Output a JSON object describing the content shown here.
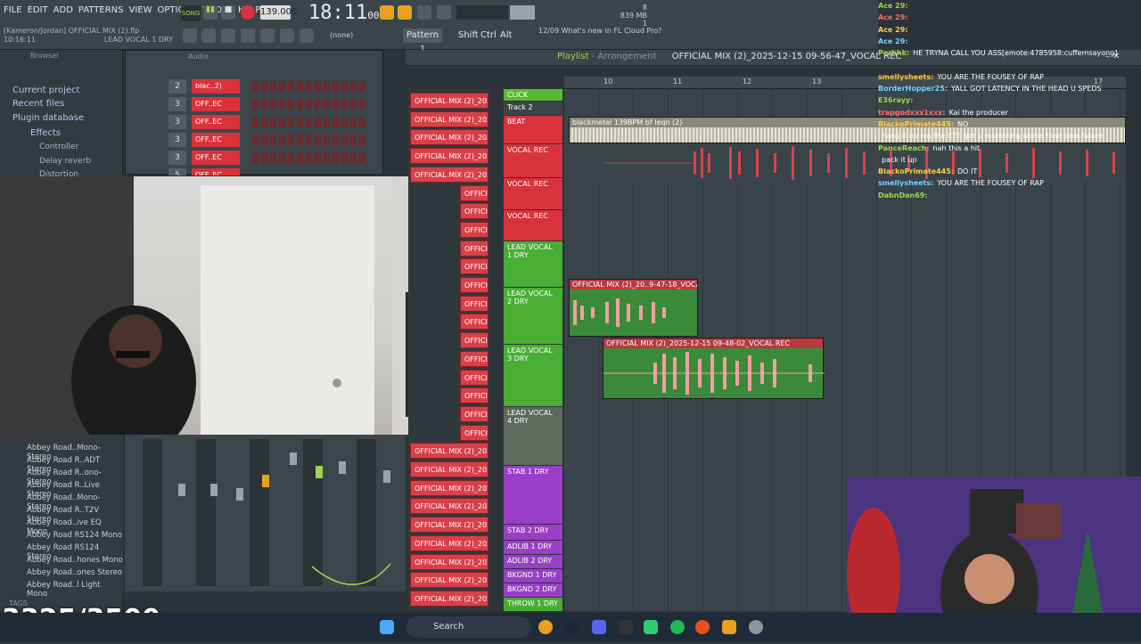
{
  "menu": [
    "FILE",
    "EDIT",
    "ADD",
    "PATTERNS",
    "VIEW",
    "OPTIONS",
    "TOOLS",
    "HELP"
  ],
  "toolbar": {
    "song_label": "SONG",
    "bpm": "139.000",
    "clock": "18:11",
    "clock_small": "00",
    "file_title": "[Kameron/Jordan] OFFICIAL MIX (2).flp",
    "time_left": "10:16:11",
    "channel_label": "LEAD VOCAL 1 DRY",
    "pattern": "Pattern 1",
    "none_label": "(none)",
    "news_date": "12/09",
    "news_text": "What's new in FL Cloud Pro?",
    "mem_a": "8",
    "mem_b": "839 MB",
    "mem_c": "1",
    "shift_label": "Shift",
    "ctrl_label": "Ctrl",
    "alt_label": "Alt"
  },
  "browser": {
    "title": "Browser",
    "items": [
      "Current project",
      "Recent files",
      "Plugin database",
      "Effects"
    ],
    "sub_items": [
      "Controller",
      "Delay reverb",
      "Distortion"
    ],
    "plugins": [
      "Abbey Road..Mono-Stereo",
      "Abbey Road R..ADT Stereo",
      "Abbey Road R..ono-Stereo",
      "Abbey Road R..Live Stereo",
      "Abbey Road..Mono-Stereo",
      "Abbey Road R..T2V Stereo",
      "Abbey Road..ive EQ Mono",
      "Abbey Road RS124 Mono",
      "Abbey Road RS124 Stereo",
      "Abbey Road..hones Mono",
      "Abbey Road..ones Stereo",
      "Abbey Road..l Light Mono"
    ],
    "tags_label": "TAGS"
  },
  "rack": {
    "header": "Audio",
    "channels": [
      {
        "num": "2",
        "name": "blac..2)"
      },
      {
        "num": "3",
        "name": "OFF..EC"
      },
      {
        "num": "3",
        "name": "OFF..EC"
      },
      {
        "num": "3",
        "name": "OFF..EC"
      },
      {
        "num": "3",
        "name": "OFF..EC"
      },
      {
        "num": "5",
        "name": "OFF..EC"
      }
    ]
  },
  "playlist": {
    "label": "Playlist",
    "section": "Arrangement",
    "title": "OFFICIAL MIX (2)_2025-12-15 09-56-47_VOCAL REC",
    "ruler": [
      "10",
      "11",
      "12",
      "13",
      "17"
    ],
    "clip_label": "OFFICIAL MIX (2)_2025-1..",
    "tracks": [
      {
        "name": "CLICK",
        "color": "#5ab832"
      },
      {
        "name": "Track 2",
        "color": "#3a4449"
      },
      {
        "name": "BEAT",
        "color": "#d8323c"
      },
      {
        "name": "VOCAL REC",
        "color": "#d8323c"
      },
      {
        "name": "VOCAL REC",
        "color": "#d8323c"
      },
      {
        "name": "VOCAL REC",
        "color": "#d8323c"
      },
      {
        "name": "LEAD VOCAL 1 DRY",
        "color": "#4aae34"
      },
      {
        "name": "LEAD VOCAL 2 DRY",
        "color": "#4aae34"
      },
      {
        "name": "LEAD VOCAL 3 DRY",
        "color": "#4aae34"
      },
      {
        "name": "LEAD VOCAL 4 DRY",
        "color": "#5a6a5c"
      },
      {
        "name": "STAB 1 DRY",
        "color": "#9a3ec8"
      },
      {
        "name": "STAB 2 DRY",
        "color": "#9a3ec8"
      },
      {
        "name": "ADLIB 1 DRY",
        "color": "#9a3ec8"
      },
      {
        "name": "ADLIB 2 DRY",
        "color": "#9a3ec8"
      },
      {
        "name": "BKGND 1 DRY",
        "color": "#9a3ec8"
      },
      {
        "name": "BKGND 2 DRY",
        "color": "#9a3ec8"
      },
      {
        "name": "THROW 1 DRY",
        "color": "#4aae34"
      }
    ],
    "audio_clips": {
      "beat": "blackmetal 139BPM bf leqn (2)",
      "lead2": "OFFICIAL MIX (2)_20..9-47-18_VOCAL REC",
      "lead3": "OFFICIAL MIX (2)_2025-12-15 09-48-02_VOCAL REC"
    }
  },
  "chat": [
    {
      "user": "Ace 29:",
      "msg": ""
    },
    {
      "user": "Ace 29:",
      "msg": ""
    },
    {
      "user": "Ace 29:",
      "msg": ""
    },
    {
      "user": "Ace 29:",
      "msg": ""
    },
    {
      "user": "Perhhk:",
      "msg": "HE TRYNA CALL YOU ASS[emote:4785958:cuffemsayong]"
    },
    {
      "user": "",
      "msg": ""
    },
    {
      "user": "smellysheets:",
      "msg": "YOU ARE THE FOUSEY OF RAP"
    },
    {
      "user": "BorderHopper25:",
      "msg": "YALL GOT LATENCY IN THE HEAD U SPEDS"
    },
    {
      "user": "E36rayy:",
      "msg": ""
    },
    {
      "user": "trapgodxxx1xxx:",
      "msg": "Kai the producer"
    },
    {
      "user": "BlackoPrimate445:",
      "msg": "NO"
    },
    {
      "user": "",
      "msg": "hang it up nig the CTE got u mumbling worse than jake future"
    },
    {
      "user": "PanceReach:",
      "msg": "nah this a hit"
    },
    {
      "user": "",
      "msg": "pack it up"
    },
    {
      "user": "BlackoPrimate445:",
      "msg": "DO IT"
    },
    {
      "user": "smellysheets:",
      "msg": "YOU ARE THE FOUSEY OF RAP"
    },
    {
      "user": "DabnDan69:",
      "msg": ""
    }
  ],
  "counter": "3325/3500",
  "taskbar": {
    "search": "Search"
  },
  "colors": {
    "accent": "#9fd44c",
    "red": "#d8323c",
    "green": "#4aae34",
    "purple": "#9a3ec8"
  }
}
